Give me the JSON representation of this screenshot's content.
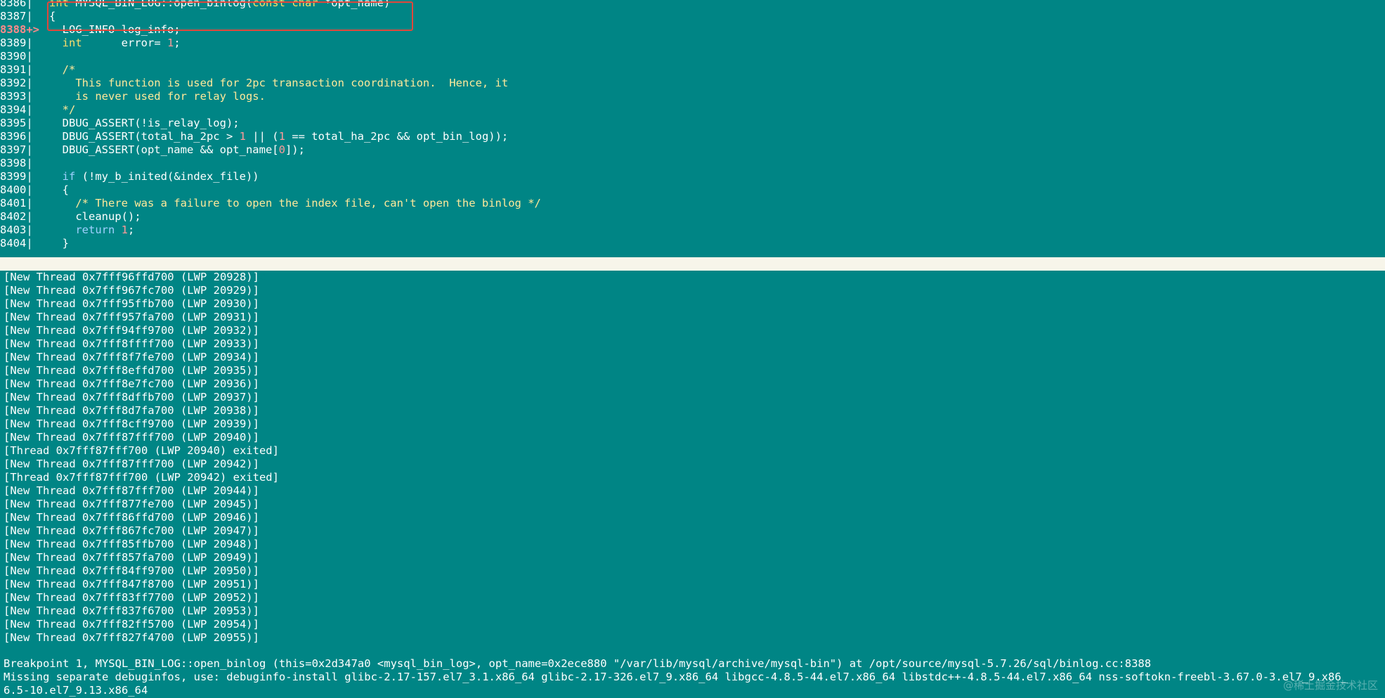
{
  "source": {
    "lines": [
      {
        "num": "8386|",
        "parts": [
          {
            "t": "kw",
            "v": "int"
          },
          {
            "t": "txt",
            "v": " MYSQL_BIN_LOG::open_binlog("
          },
          {
            "t": "kw",
            "v": "const"
          },
          {
            "t": "txt",
            "v": " "
          },
          {
            "t": "kw",
            "v": "char"
          },
          {
            "t": "txt",
            "v": " *opt_name)"
          }
        ]
      },
      {
        "num": "8387|",
        "parts": [
          {
            "t": "txt",
            "v": "{"
          }
        ]
      },
      {
        "num": "8388+>",
        "current": true,
        "parts": [
          {
            "t": "txt",
            "v": "  LOG_INFO log_info;"
          }
        ]
      },
      {
        "num": "8389|",
        "parts": [
          {
            "t": "txt",
            "v": "  "
          },
          {
            "t": "kw",
            "v": "int"
          },
          {
            "t": "txt",
            "v": "      error= "
          },
          {
            "t": "num",
            "v": "1"
          },
          {
            "t": "txt",
            "v": ";"
          }
        ]
      },
      {
        "num": "8390|",
        "parts": []
      },
      {
        "num": "8391|",
        "parts": [
          {
            "t": "cmt",
            "v": "  /*"
          }
        ]
      },
      {
        "num": "8392|",
        "parts": [
          {
            "t": "cmt",
            "v": "    This function is used for 2pc transaction coordination.  Hence, it"
          }
        ]
      },
      {
        "num": "8393|",
        "parts": [
          {
            "t": "cmt",
            "v": "    is never used for relay logs."
          }
        ]
      },
      {
        "num": "8394|",
        "parts": [
          {
            "t": "cmt",
            "v": "  */"
          }
        ]
      },
      {
        "num": "8395|",
        "parts": [
          {
            "t": "txt",
            "v": "  DBUG_ASSERT(!is_relay_log);"
          }
        ]
      },
      {
        "num": "8396|",
        "parts": [
          {
            "t": "txt",
            "v": "  DBUG_ASSERT(total_ha_2pc > "
          },
          {
            "t": "num",
            "v": "1"
          },
          {
            "t": "txt",
            "v": " || ("
          },
          {
            "t": "num",
            "v": "1"
          },
          {
            "t": "txt",
            "v": " == total_ha_2pc && opt_bin_log));"
          }
        ]
      },
      {
        "num": "8397|",
        "parts": [
          {
            "t": "txt",
            "v": "  DBUG_ASSERT(opt_name && opt_name["
          },
          {
            "t": "num",
            "v": "0"
          },
          {
            "t": "txt",
            "v": "]);"
          }
        ]
      },
      {
        "num": "8398|",
        "parts": []
      },
      {
        "num": "8399|",
        "parts": [
          {
            "t": "txt",
            "v": "  "
          },
          {
            "t": "kw2",
            "v": "if"
          },
          {
            "t": "txt",
            "v": " (!my_b_inited(&index_file))"
          }
        ]
      },
      {
        "num": "8400|",
        "parts": [
          {
            "t": "txt",
            "v": "  {"
          }
        ]
      },
      {
        "num": "8401|",
        "parts": [
          {
            "t": "cmt",
            "v": "    /* There was a failure to open the index file, can't open the binlog */"
          }
        ]
      },
      {
        "num": "8402|",
        "parts": [
          {
            "t": "txt",
            "v": "    cleanup();"
          }
        ]
      },
      {
        "num": "8403|",
        "parts": [
          {
            "t": "txt",
            "v": "    "
          },
          {
            "t": "kw2",
            "v": "return"
          },
          {
            "t": "txt",
            "v": " "
          },
          {
            "t": "num",
            "v": "1"
          },
          {
            "t": "txt",
            "v": ";"
          }
        ]
      },
      {
        "num": "8404|",
        "parts": [
          {
            "t": "txt",
            "v": "  }"
          }
        ]
      }
    ]
  },
  "status": {
    "file_path": "/opt/source/mysql-5.7.26/sql/binlog.cc"
  },
  "gdb_output": [
    "[New Thread 0x7fff96ffd700 (LWP 20928)]",
    "[New Thread 0x7fff967fc700 (LWP 20929)]",
    "[New Thread 0x7fff95ffb700 (LWP 20930)]",
    "[New Thread 0x7fff957fa700 (LWP 20931)]",
    "[New Thread 0x7fff94ff9700 (LWP 20932)]",
    "[New Thread 0x7fff8ffff700 (LWP 20933)]",
    "[New Thread 0x7fff8f7fe700 (LWP 20934)]",
    "[New Thread 0x7fff8effd700 (LWP 20935)]",
    "[New Thread 0x7fff8e7fc700 (LWP 20936)]",
    "[New Thread 0x7fff8dffb700 (LWP 20937)]",
    "[New Thread 0x7fff8d7fa700 (LWP 20938)]",
    "[New Thread 0x7fff8cff9700 (LWP 20939)]",
    "[New Thread 0x7fff87fff700 (LWP 20940)]",
    "[Thread 0x7fff87fff700 (LWP 20940) exited]",
    "[New Thread 0x7fff87fff700 (LWP 20942)]",
    "[Thread 0x7fff87fff700 (LWP 20942) exited]",
    "[New Thread 0x7fff87fff700 (LWP 20944)]",
    "[New Thread 0x7fff877fe700 (LWP 20945)]",
    "[New Thread 0x7fff86ffd700 (LWP 20946)]",
    "[New Thread 0x7fff867fc700 (LWP 20947)]",
    "[New Thread 0x7fff85ffb700 (LWP 20948)]",
    "[New Thread 0x7fff857fa700 (LWP 20949)]",
    "[New Thread 0x7fff84ff9700 (LWP 20950)]",
    "[New Thread 0x7fff847f8700 (LWP 20951)]",
    "[New Thread 0x7fff83ff7700 (LWP 20952)]",
    "[New Thread 0x7fff837f6700 (LWP 20953)]",
    "[New Thread 0x7fff82ff5700 (LWP 20954)]",
    "[New Thread 0x7fff827f4700 (LWP 20955)]"
  ],
  "breakpoint": {
    "line1": "Breakpoint 1, MYSQL_BIN_LOG::open_binlog (this=0x2d347a0 <mysql_bin_log>, opt_name=0x2ece880 \"/var/lib/mysql/archive/mysql-bin\") at /opt/source/mysql-5.7.26/sql/binlog.cc:8388",
    "line2": "Missing separate debuginfos, use: debuginfo-install glibc-2.17-157.el7_3.1.x86_64 glibc-2.17-326.el7_9.x86_64 libgcc-4.8.5-44.el7.x86_64 libstdc++-4.8.5-44.el7.x86_64 nss-softokn-freebl-3.67.0-3.el7_9.x86_",
    "line3": "6.5-10.el7_9.13.x86_64"
  },
  "watermark": "@稀土掘金技术社区",
  "colors": {
    "background": "#008585",
    "status_bar_bg": "#f7f5ea",
    "highlight_box": "#e2473b",
    "keyword": "#ffdf6b",
    "number": "#ff9a9a"
  }
}
